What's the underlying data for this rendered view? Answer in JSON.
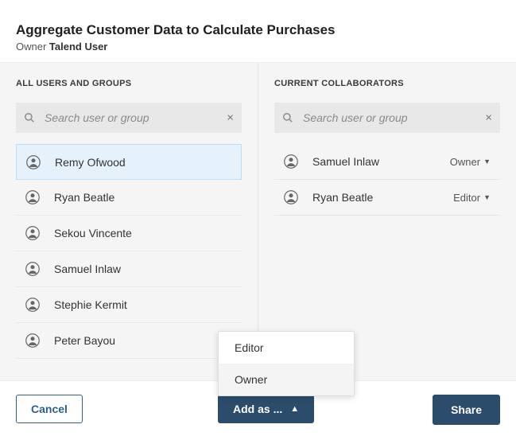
{
  "header": {
    "title": "Aggregate Customer Data to Calculate Purchases",
    "owner_label": "Owner",
    "owner_name": "Talend User"
  },
  "left": {
    "heading": "ALL USERS AND GROUPS",
    "search_placeholder": "Search user or group",
    "users": [
      {
        "name": "Remy Ofwood"
      },
      {
        "name": "Ryan Beatle"
      },
      {
        "name": "Sekou Vincente"
      },
      {
        "name": "Samuel Inlaw"
      },
      {
        "name": "Stephie Kermit"
      },
      {
        "name": "Peter Bayou"
      }
    ]
  },
  "right": {
    "heading": "CURRENT COLLABORATORS",
    "search_placeholder": "Search user or group",
    "collaborators": [
      {
        "name": "Samuel Inlaw",
        "role": "Owner"
      },
      {
        "name": "Ryan Beatle",
        "role": "Editor"
      }
    ]
  },
  "dropdown": {
    "options": [
      {
        "label": "Editor"
      },
      {
        "label": "Owner"
      }
    ]
  },
  "footer": {
    "cancel": "Cancel",
    "add_as": "Add as ...",
    "share": "Share"
  }
}
